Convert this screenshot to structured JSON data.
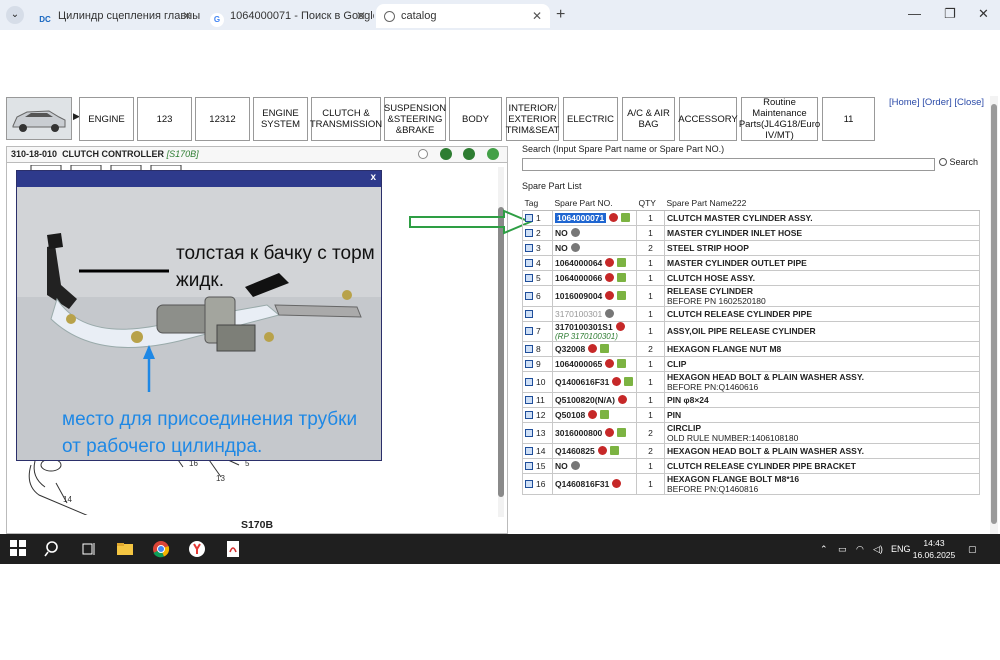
{
  "browser": {
    "tabs": [
      {
        "label": "Цилиндр сцепления главный",
        "icon": "dc-logo-icon"
      },
      {
        "label": "1064000071 - Поиск в Google",
        "icon": "google-icon"
      },
      {
        "label": "catalog",
        "icon": "globe-icon"
      }
    ],
    "fav_dc": "DC",
    "fav_g": "G"
  },
  "nav": {
    "thumb_arrow": "▶",
    "buttons": [
      "ENGINE",
      "123",
      "12312",
      "ENGINE SYSTEM",
      "CLUTCH & TRANSMISSION",
      "SUSPENSION &STEERING &BRAKE",
      "BODY",
      "INTERIOR/ EXTERIOR TRIM&SEAT",
      "ELECTRIC",
      "A/C & AIR BAG",
      "ACCESSORY",
      "Routine Maintenance Parts(JL4G18/Euro IV/MT)",
      "11"
    ],
    "home": "[Home]",
    "order": "[Order]",
    "close": "[Close]"
  },
  "left_panel": {
    "code": "310-18-010",
    "title": "CLUTCH CONTROLLER",
    "model": "[S170B]",
    "model_label": "S170B",
    "callouts": [
      "14",
      "16",
      "13",
      "5"
    ]
  },
  "photo": {
    "close": "x",
    "caption_top": [
      "толстая к бачку с торм",
      "жидк."
    ],
    "caption_bottom": [
      "место для присоединения трубки",
      "от рабочего цилиндра."
    ]
  },
  "search": {
    "label": "Search (Input Spare Part name or Spare Part NO.)",
    "value": "",
    "button": "Search"
  },
  "list": {
    "label": "Spare Part List",
    "headers": [
      "Tag",
      "Spare Part NO.",
      "QTY",
      "Spare Part Name222"
    ],
    "rows": [
      {
        "n": "1",
        "pn": "1064000071",
        "qty": "1",
        "name": "CLUTCH MASTER CYLINDER ASSY.",
        "note": ""
      },
      {
        "n": "2",
        "pn": "NO",
        "qty": "1",
        "name": "MASTER CYLINDER INLET HOSE",
        "note": ""
      },
      {
        "n": "3",
        "pn": "NO",
        "qty": "2",
        "name": "STEEL STRIP HOOP",
        "note": ""
      },
      {
        "n": "4",
        "pn": "1064000064",
        "qty": "1",
        "name": "MASTER CYLINDER OUTLET PIPE",
        "note": ""
      },
      {
        "n": "5",
        "pn": "1064000066",
        "qty": "1",
        "name": "CLUTCH HOSE ASSY.",
        "note": ""
      },
      {
        "n": "6",
        "pn": "1016009004",
        "qty": "1",
        "name": "RELEASE CYLINDER",
        "note": "BEFORE PN 1602520180"
      },
      {
        "n": "",
        "pn": "3170100301",
        "qty": "1",
        "name": "CLUTCH RELEASE CYLINDER PIPE",
        "note": ""
      },
      {
        "n": "7",
        "pn": "3170100301S1",
        "qty": "1",
        "name": "ASSY,OIL PIPE RELEASE CYLINDER",
        "note": "",
        "sub": "(RP 3170100301)"
      },
      {
        "n": "8",
        "pn": "Q32008",
        "qty": "2",
        "name": "HEXAGON FLANGE NUT M8",
        "note": ""
      },
      {
        "n": "9",
        "pn": "1064000065",
        "qty": "1",
        "name": "CLIP",
        "note": ""
      },
      {
        "n": "10",
        "pn": "Q1400616F31",
        "qty": "1",
        "name": "HEXAGON HEAD BOLT & PLAIN WASHER ASSY.",
        "note": "BEFORE PN:Q1460616"
      },
      {
        "n": "11",
        "pn": "Q5100820(N/A)",
        "qty": "1",
        "name": "PIN φ8×24",
        "note": ""
      },
      {
        "n": "12",
        "pn": "Q50108",
        "qty": "1",
        "name": "PIN",
        "note": ""
      },
      {
        "n": "13",
        "pn": "3016000800",
        "qty": "2",
        "name": "CIRCLIP",
        "note": "OLD RULE NUMBER:1406108180"
      },
      {
        "n": "14",
        "pn": "Q1460825",
        "qty": "2",
        "name": "HEXAGON HEAD BOLT & PLAIN WASHER ASSY.",
        "note": ""
      },
      {
        "n": "15",
        "pn": "NO",
        "qty": "1",
        "name": "CLUTCH RELEASE CYLINDER PIPE BRACKET",
        "note": ""
      },
      {
        "n": "16",
        "pn": "Q1460816F31",
        "qty": "1",
        "name": "HEXAGON FLANGE BOLT M8*16",
        "note": "BEFORE PN:Q1460816"
      }
    ]
  },
  "taskbar": {
    "lang": "ENG",
    "time": "14:43",
    "date": "16.06.2025"
  },
  "colors": {
    "accent": "#1f66d1",
    "arrow": "#2e9e44",
    "caption_blue": "#1e88e5",
    "cart": "#c62828"
  }
}
